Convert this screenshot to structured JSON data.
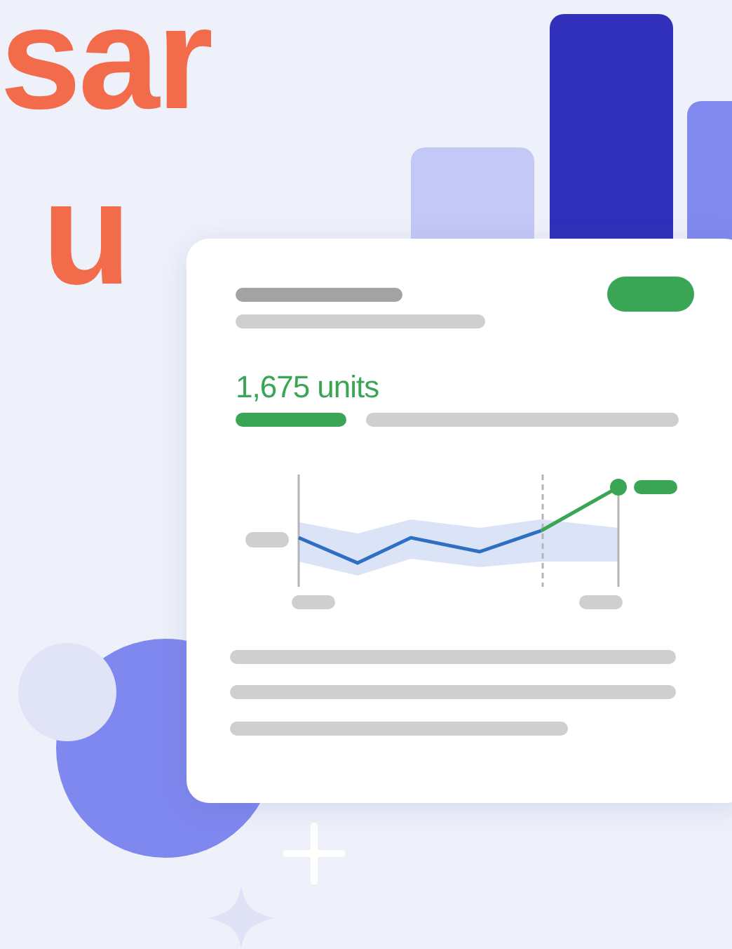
{
  "hero": {
    "heading_lines": [
      "sar",
      "u"
    ]
  },
  "card": {
    "metric": "1,675 units"
  }
}
